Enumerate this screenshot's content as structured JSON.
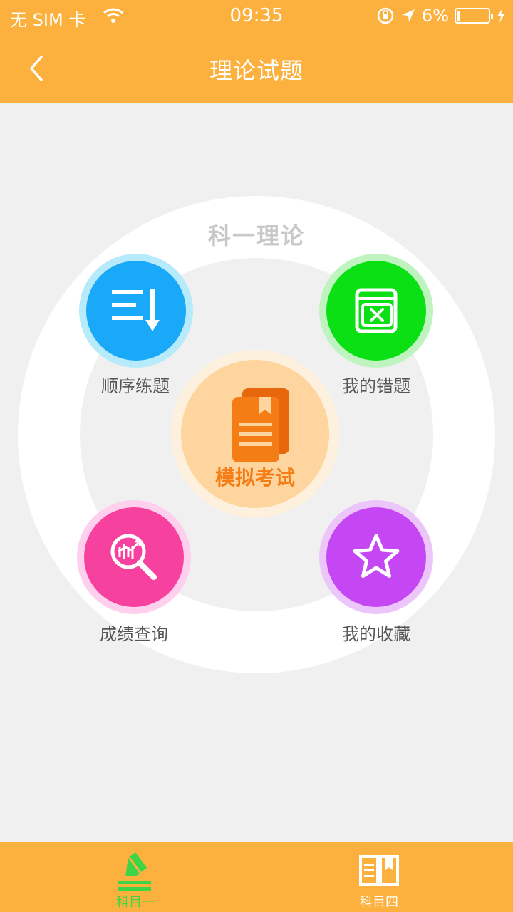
{
  "status_bar": {
    "carrier": "无 SIM 卡",
    "time": "09:35",
    "battery": "6%",
    "battery_level": 0.06
  },
  "header": {
    "title": "理论试题",
    "back_icon": "chevron-left-icon"
  },
  "main": {
    "section_title": "科一理论",
    "features": {
      "sequential": {
        "label": "顺序练题",
        "icon": "list-sort-down-icon",
        "color": "#1aa9f8"
      },
      "wrong": {
        "label": "我的错题",
        "icon": "wrong-book-icon",
        "color": "#0be015"
      },
      "exam": {
        "label": "模拟考试",
        "icon": "documents-icon",
        "color": "#f47d16"
      },
      "score": {
        "label": "成绩查询",
        "icon": "magnifier-chart-icon",
        "color": "#f7419f"
      },
      "favorites": {
        "label": "我的收藏",
        "icon": "star-icon",
        "color": "#c547f3"
      }
    }
  },
  "tabbar": {
    "tabs": [
      {
        "label": "科目一",
        "icon": "pencil-edit-icon",
        "active": true
      },
      {
        "label": "科目四",
        "icon": "open-book-icon",
        "active": false
      }
    ]
  },
  "colors": {
    "brand": "#fcb13f",
    "background": "#f0f0f0",
    "active_tab": "#3fd445"
  }
}
